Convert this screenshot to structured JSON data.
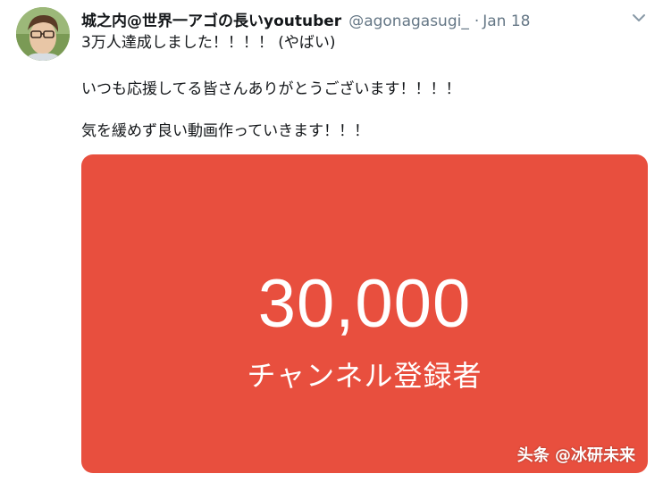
{
  "tweet": {
    "display_name": "城之内@世界一アゴの長いyoutuber",
    "handle": "@agonagasugi_",
    "separator": "·",
    "date": "Jan 18",
    "text_lines": [
      "3万人達成しました！！！！ (やばい)",
      "いつも応援してる皆さんありがとうございます！！！！",
      "気を緩めず良い動画作っていきます！！！"
    ],
    "media": {
      "number": "30,000",
      "label": "チャンネル登録者",
      "background_color": "#e84f3e"
    }
  },
  "watermark": "头条 @冰研未来",
  "icons": {
    "caret": "chevron-down-icon",
    "avatar": "avatar"
  },
  "colors": {
    "text": "#14171a",
    "secondary": "#657786",
    "media_bg": "#e84f3e"
  }
}
